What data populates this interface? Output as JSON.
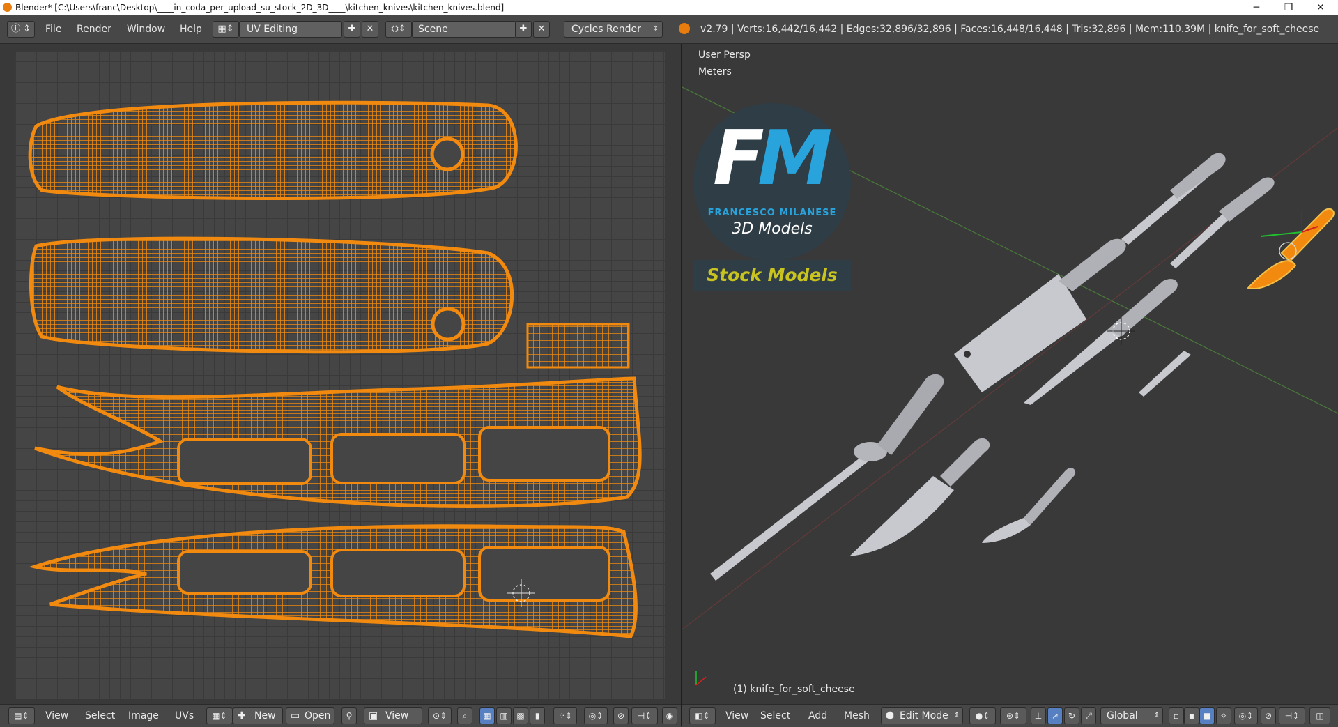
{
  "window": {
    "title": "Blender* [C:\\Users\\franc\\Desktop\\____in_coda_per_upload_su_stock_2D_3D____\\kitchen_knives\\kitchen_knives.blend]",
    "minimize": "─",
    "maximize": "❐",
    "close": "✕"
  },
  "info_header": {
    "menus": [
      "File",
      "Render",
      "Window",
      "Help"
    ],
    "screen_layout": "UV Editing",
    "scene": "Scene",
    "render_engine": "Cycles Render",
    "stats": "v2.79 | Verts:16,442/16,442 | Edges:32,896/32,896 | Faces:16,448/16,448 | Tris:32,896 | Mem:110.39M | knife_for_soft_cheese"
  },
  "uv_editor": {
    "menus": [
      "View",
      "Select",
      "Image",
      "UVs"
    ],
    "new_label": "New",
    "open_label": "Open",
    "view_label": "View",
    "uv_color": "#f28a0f"
  },
  "viewport": {
    "view_name": "User Persp",
    "units": "Meters",
    "object_label": "(1) knife_for_soft_cheese",
    "menus": [
      "View",
      "Select",
      "Add",
      "Mesh"
    ],
    "mode": "Edit Mode",
    "orientation": "Global"
  },
  "logo": {
    "letter_f": "F",
    "letter_m": "M",
    "name": "FRANCESCO MILANESE",
    "sub": "3D Models",
    "stock": "Stock Models"
  }
}
